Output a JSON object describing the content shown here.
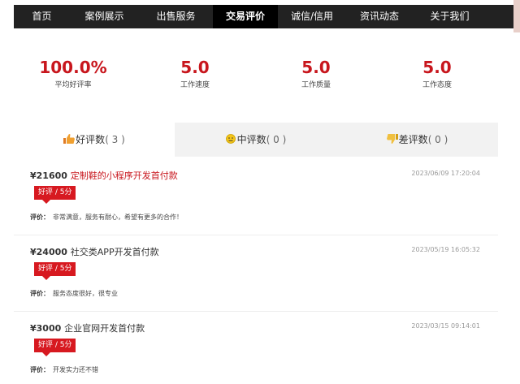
{
  "nav": {
    "items": [
      {
        "label": "首页"
      },
      {
        "label": "案例展示"
      },
      {
        "label": "出售服务"
      },
      {
        "label": "交易评价"
      },
      {
        "label": "诚信/信用"
      },
      {
        "label": "资讯动态"
      },
      {
        "label": "关于我们"
      }
    ],
    "active_index": 3
  },
  "stats": [
    {
      "value": "100.0%",
      "label": "平均好评率"
    },
    {
      "value": "5.0",
      "label": "工作速度"
    },
    {
      "value": "5.0",
      "label": "工作质量"
    },
    {
      "value": "5.0",
      "label": "工作态度"
    }
  ],
  "tabs": [
    {
      "label": "好评数",
      "count_text": "( 3 )",
      "icon": "thumbs-up-icon"
    },
    {
      "label": "中评数",
      "count_text": "( 0 )",
      "icon": "neutral-face-icon"
    },
    {
      "label": "差评数",
      "count_text": "( 0 )",
      "icon": "thumbs-down-icon"
    }
  ],
  "reviews": [
    {
      "price": "¥21600",
      "name": "定制鞋的小程序开发首付款",
      "date": "2023/06/09 17:20:04",
      "badge": "好评 / 5分",
      "comment_label": "评价：",
      "comment": "非常满意，服务有耐心，希望有更多的合作！"
    },
    {
      "price": "¥24000",
      "name": "社交类APP开发首付款",
      "date": "2023/05/19 16:05:32",
      "badge": "好评 / 5分",
      "comment_label": "评价：",
      "comment": "服务态度很好，很专业"
    },
    {
      "price": "¥3000",
      "name": "企业官网开发首付款",
      "date": "2023/03/15 09:14:01",
      "badge": "好评 / 5分",
      "comment_label": "评价：",
      "comment": "开发实力还不错"
    }
  ],
  "colors": {
    "accent": "#c8161d",
    "nav_bg": "#222222",
    "badge": "#d71920"
  }
}
